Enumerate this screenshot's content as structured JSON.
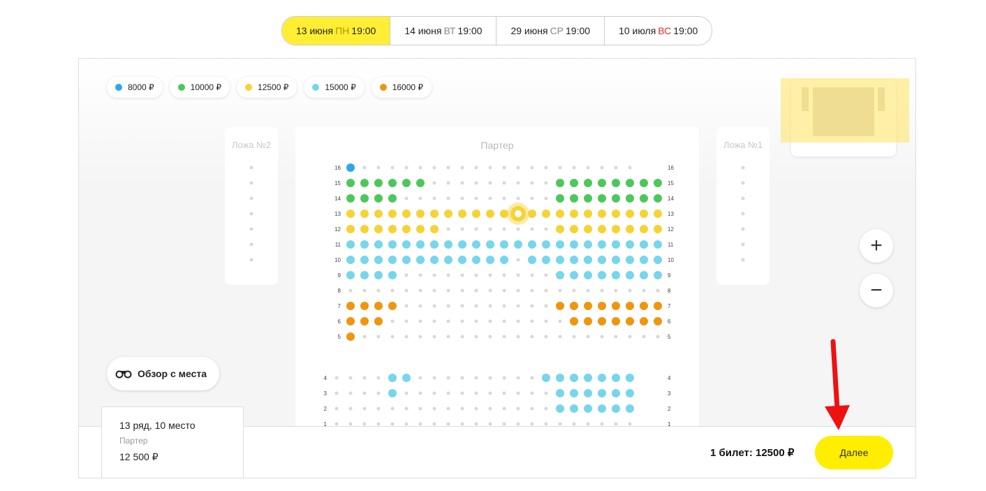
{
  "dates": [
    {
      "date": "13 июня",
      "dow": "ПН",
      "time": "19:00",
      "active": true,
      "dow_style": "gold"
    },
    {
      "date": "14 июня",
      "dow": "ВТ",
      "time": "19:00",
      "active": false,
      "dow_style": "grey"
    },
    {
      "date": "29 июня",
      "dow": "СР",
      "time": "19:00",
      "active": false,
      "dow_style": "grey"
    },
    {
      "date": "10 июля",
      "dow": "ВС",
      "time": "19:00",
      "active": false,
      "dow_style": "red"
    }
  ],
  "legend": [
    {
      "label": "8000 ₽",
      "color": "#29a9e8"
    },
    {
      "label": "10000 ₽",
      "color": "#4cc85a"
    },
    {
      "label": "12500 ₽",
      "color": "#f7d233"
    },
    {
      "label": "15000 ₽",
      "color": "#75d6ec"
    },
    {
      "label": "16000 ₽",
      "color": "#f0950e"
    }
  ],
  "sectors": {
    "parterre": "Партер",
    "box2": "Ложа №2",
    "box1": "Ложа №1"
  },
  "seatmap": {
    "seats_per_row": 22,
    "empty_color": "#d8d8d8",
    "upper_rows": [
      {
        "row": 16,
        "seats": "8.................... ",
        "label_right": "16"
      },
      {
        "row": 15,
        "seats": "AAAAAA.........AAAAAAAA",
        "label_right": "15"
      },
      {
        "row": 14,
        "seats": "AAAA...........AAAAAAAA",
        "label_right": "14"
      },
      {
        "row": 13,
        "seats": "BBBBBBBBBBBBXBBBBBBBBBB",
        "label_right": "13"
      },
      {
        "row": 12,
        "seats": "BBBBBBB........BBBBBBBB",
        "label_right": "12"
      },
      {
        "row": 11,
        "seats": "CCCCCCCCCCCCCCCCCCCCCCC",
        "label_right": "11"
      },
      {
        "row": 10,
        "seats": "CCCCCCCCCCCC.CCCCCCCCCC",
        "label_right": "10"
      },
      {
        "row": 9,
        "seats": "CCCC...........CCCCCCCC",
        "label_right": "9"
      },
      {
        "row": 8,
        "seats": ".......................",
        "label_right": "8"
      },
      {
        "row": 7,
        "seats": "DDDD...........DDDDDDDD",
        "label_right": "7"
      },
      {
        "row": 6,
        "seats": "DDD.............DDDDDDD",
        "label_right": "6"
      },
      {
        "row": 5,
        "seats": "D......................",
        "label_right": "5"
      }
    ],
    "lower_rows": [
      {
        "row": 4,
        "seats": "....CC.........CCCCCCC",
        "label_right": "4"
      },
      {
        "row": 3,
        "seats": "....C...........CCCCCC",
        "label_right": "3"
      },
      {
        "row": 2,
        "seats": "................CCCCCC",
        "label_right": "2"
      },
      {
        "row": 1,
        "seats": "......................",
        "label_right": "1"
      }
    ],
    "box_seats": 7
  },
  "view_button": "Обзор с места",
  "zoom": {
    "plus": "+",
    "minus": "−"
  },
  "selected": {
    "title": "13 ряд, 10 место",
    "sector": "Партер",
    "price": "12 500 ₽"
  },
  "total": "1 билет:  12500 ₽",
  "next_button": "Далее",
  "colors": {
    "accent": "#ffee00",
    "annotation_arrow": "#ee1111"
  }
}
